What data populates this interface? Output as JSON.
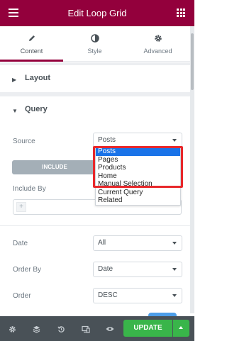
{
  "header": {
    "title": "Edit Loop Grid"
  },
  "tabs": [
    {
      "label": "Content",
      "icon": "pencil-icon",
      "active": true
    },
    {
      "label": "Style",
      "icon": "contrast-icon",
      "active": false
    },
    {
      "label": "Advanced",
      "icon": "gear-icon",
      "active": false
    }
  ],
  "sections": {
    "layout": {
      "title": "Layout"
    },
    "query": {
      "title": "Query"
    }
  },
  "query": {
    "source": {
      "label": "Source",
      "value": "Posts"
    },
    "include_tab": "INCLUDE",
    "include_by": {
      "label": "Include By"
    },
    "date": {
      "label": "Date",
      "value": "All"
    },
    "order_by": {
      "label": "Order By",
      "value": "Date"
    },
    "order": {
      "label": "Order",
      "value": "DESC"
    }
  },
  "source_dropdown": {
    "options": [
      "Posts",
      "Pages",
      "Products",
      "Home",
      "Manual Selection",
      "Current Query",
      "Related"
    ],
    "selected": "Posts",
    "highlight_color": "#e8282b"
  },
  "footer": {
    "update_label": "UPDATE"
  },
  "colors": {
    "brand": "#93003c",
    "update": "#39b54a",
    "footer": "#495157"
  }
}
